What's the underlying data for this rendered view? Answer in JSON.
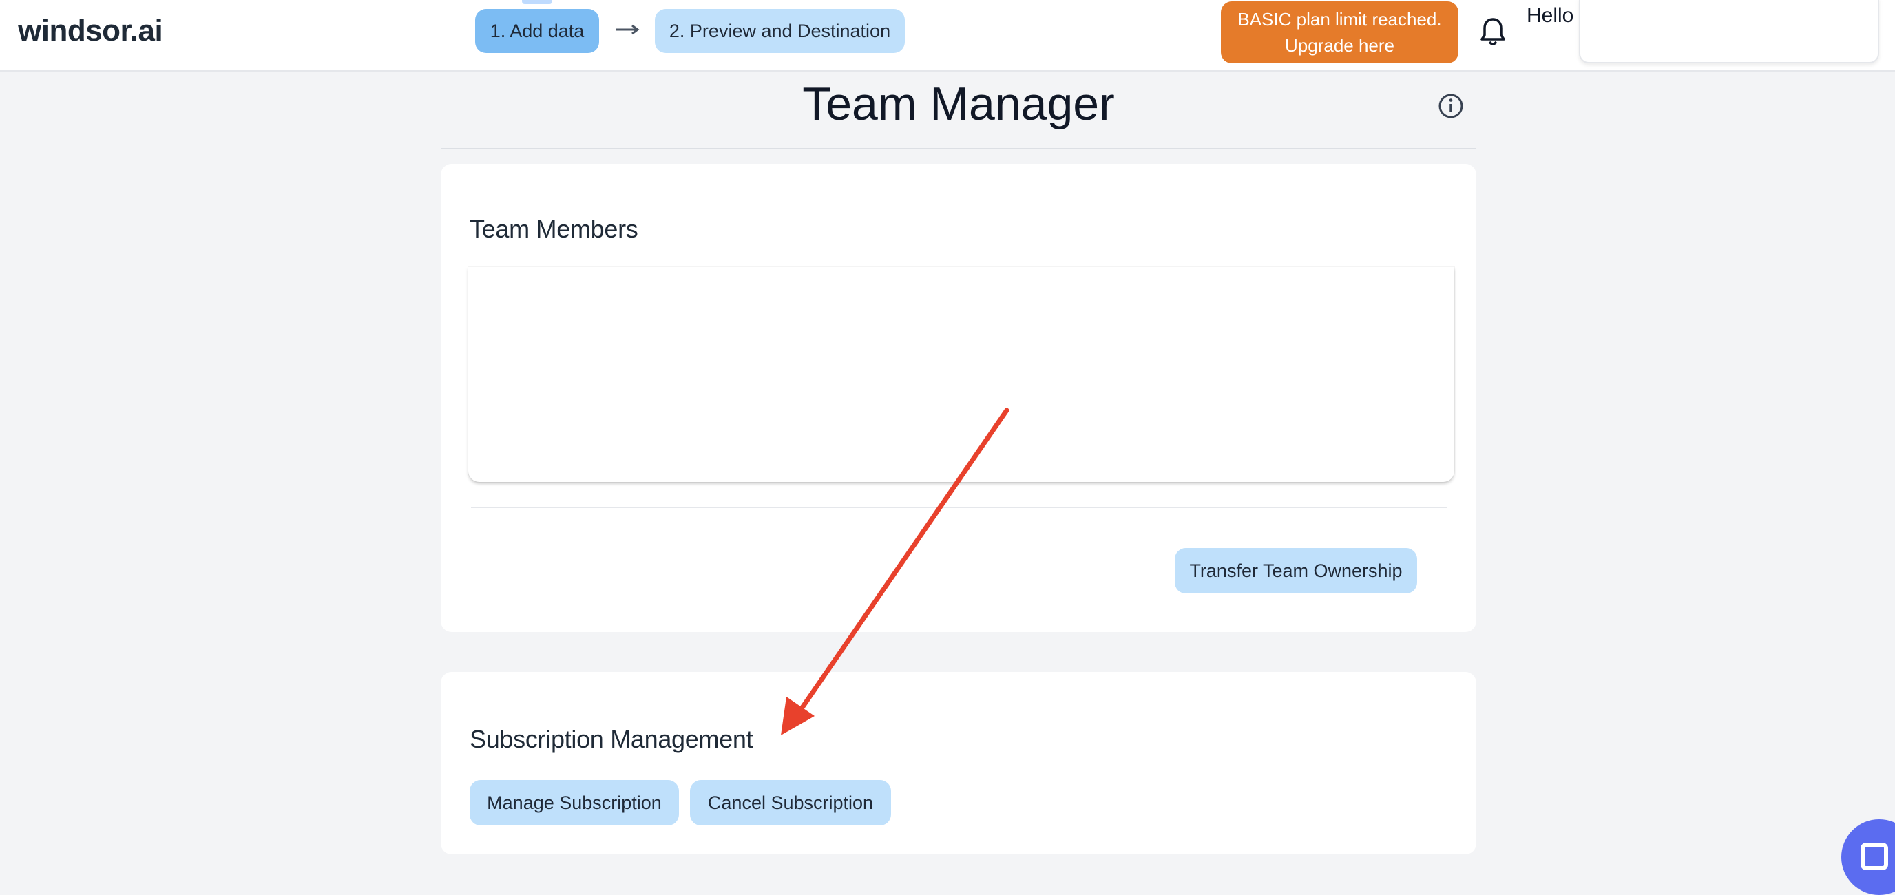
{
  "header": {
    "logo_text": "windsor.ai",
    "steps": [
      {
        "label": "1. Add data"
      },
      {
        "label": "2. Preview and Destination"
      }
    ],
    "upgrade": {
      "line1": "BASIC plan limit reached.",
      "line2": "Upgrade here",
      "color": "#e57b2a"
    },
    "greeting": "Hello"
  },
  "page": {
    "title": "Team Manager"
  },
  "team_members": {
    "heading": "Team Members",
    "transfer_label": "Transfer Team Ownership"
  },
  "subscription": {
    "heading": "Subscription Management",
    "manage_label": "Manage Subscription",
    "cancel_label": "Cancel Subscription"
  },
  "colors": {
    "accent_light": "#bfe0fb",
    "accent_active": "#7cbcf3",
    "annotation_arrow": "#e8412c",
    "chat_widget": "#5b6cf0"
  },
  "icons": {
    "notifications": "bell-icon",
    "info": "info-icon",
    "step_separator": "arrow-right-icon",
    "chat": "chat-icon"
  }
}
